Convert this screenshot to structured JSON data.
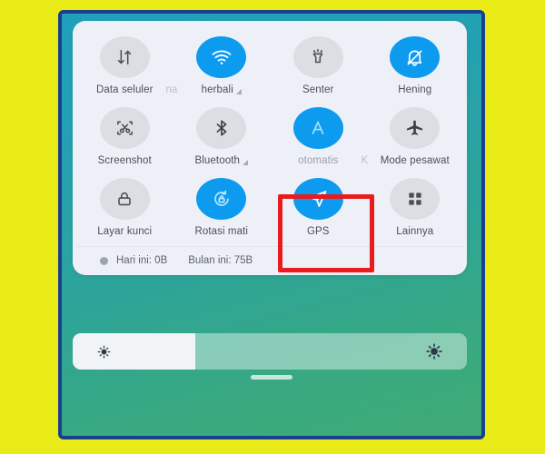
{
  "window": {
    "background_color": "#e8eb15",
    "frame_border_color": "#1b3f8f"
  },
  "wallpaper": {
    "gradient_from": "#1fa0bb",
    "gradient_to": "#3fab74"
  },
  "quick_settings": {
    "panel_background": "#eef0f7",
    "active_color": "#0d9bf0",
    "inactive_color": "#dcdee4",
    "rows": [
      {
        "tiles": [
          {
            "label": "Data seluler",
            "icon": "data-transfer-icon",
            "active": false,
            "has_signal_glyph": false,
            "ghost_label": null
          },
          {
            "label": "herbali",
            "icon": "wifi-icon",
            "active": true,
            "has_signal_glyph": true,
            "ghost_label": "na"
          },
          {
            "label": "Senter",
            "icon": "flashlight-icon",
            "active": false,
            "has_signal_glyph": false,
            "ghost_label": null
          },
          {
            "label": "Hening",
            "icon": "bell-off-icon",
            "active": true,
            "has_signal_glyph": false,
            "ghost_label": null
          }
        ]
      },
      {
        "tiles": [
          {
            "label": "Screenshot",
            "icon": "screenshot-icon",
            "active": false,
            "has_signal_glyph": false,
            "ghost_label": null
          },
          {
            "label": "Bluetooth",
            "icon": "bluetooth-icon",
            "active": false,
            "has_signal_glyph": true,
            "ghost_label": null
          },
          {
            "label": "otomatis",
            "icon": "auto-brightness-icon",
            "active": true,
            "has_signal_glyph": false,
            "ghost_label": null
          },
          {
            "label": "Mode pesawat",
            "icon": "airplane-icon",
            "active": false,
            "has_signal_glyph": false,
            "ghost_label": "K"
          }
        ]
      },
      {
        "tiles": [
          {
            "label": "Layar kunci",
            "icon": "lock-icon",
            "active": false,
            "has_signal_glyph": false,
            "ghost_label": null
          },
          {
            "label": "Rotasi mati",
            "icon": "rotation-lock-icon",
            "active": true,
            "has_signal_glyph": false,
            "ghost_label": null
          },
          {
            "label": "GPS",
            "icon": "location-arrow-icon",
            "active": true,
            "has_signal_glyph": false,
            "ghost_label": null
          },
          {
            "label": "Lainnya",
            "icon": "grid-apps-icon",
            "active": false,
            "has_signal_glyph": false,
            "ghost_label": null
          }
        ]
      }
    ],
    "footer": {
      "today_usage": "Hari ini: 0B",
      "month_usage": "Bulan ini: 75B"
    }
  },
  "highlight": {
    "target_tile": "GPS",
    "color": "#e81c1c"
  },
  "brightness": {
    "level_percent": 31,
    "low_icon": "brightness-low-icon",
    "high_icon": "brightness-high-icon"
  },
  "home_indicator": {
    "name": "home-gesture-bar"
  }
}
